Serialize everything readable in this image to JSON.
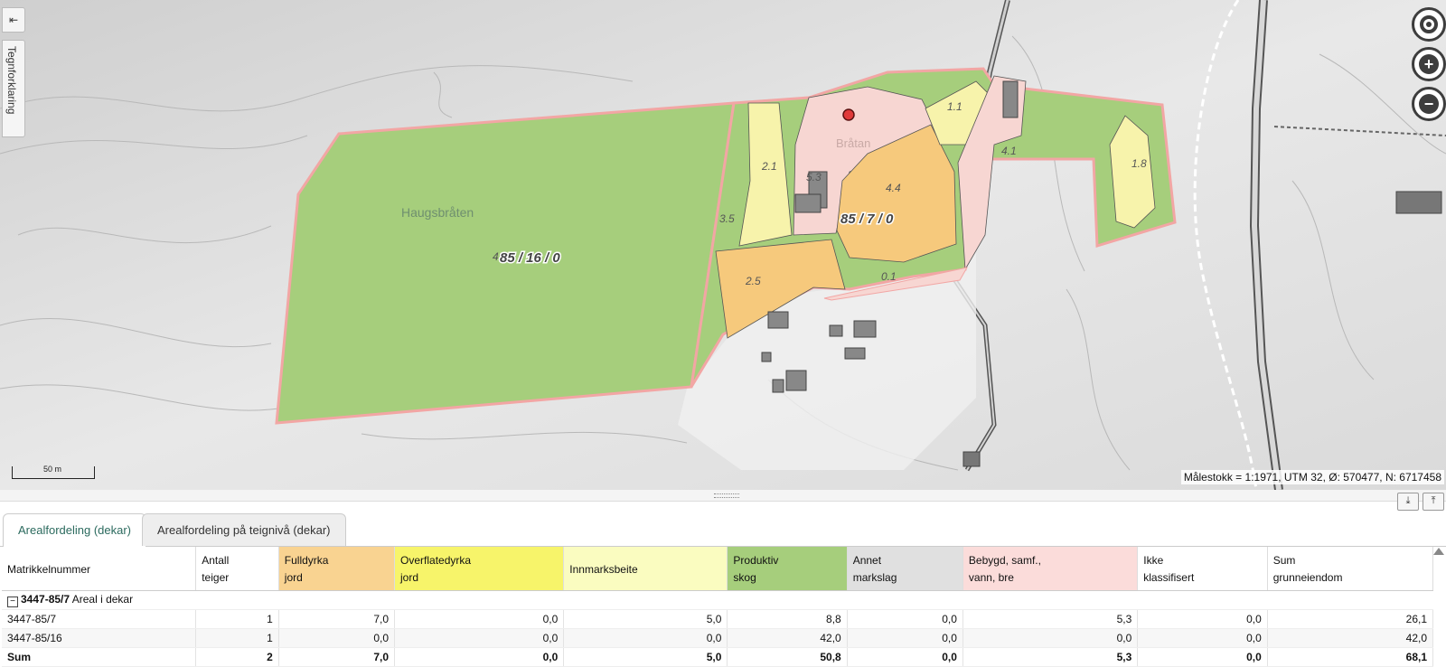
{
  "sidebar": {
    "legend_tab_label": "Tegnforklaring",
    "collapse_icon": "arrow-left-bar-icon"
  },
  "map": {
    "place_labels": [
      "Haugsbråten",
      "Bråtan"
    ],
    "parcel_labels": [
      "85 / 16 / 0",
      "85 / 7 / 0"
    ],
    "area_labels": [
      "2.1",
      "5.3",
      "4.4",
      "1.1",
      "4.1",
      "1.8",
      "3.5",
      "2.5",
      "0.1",
      "4"
    ],
    "scale_bar_label": "50 m",
    "scale_info": "Målestokk = 1:1971, UTM 32, Ø: 570477, N: 6717458",
    "colors": {
      "forest": "#a6ce7c",
      "fully_cultivated": "#f6c97c",
      "pasture": "#f7f3ab",
      "built": "#f7d6d2",
      "outline": "#f2a6a4"
    }
  },
  "map_controls": {
    "locate_icon": "locate-icon",
    "zoom_in_label": "+",
    "zoom_out_label": "−"
  },
  "panel_controls": {
    "dock_down_icon": "arrow-down-icon",
    "dock_up_icon": "arrow-up-icon"
  },
  "tabs": [
    {
      "label": "Arealfordeling (dekar)",
      "active": true
    },
    {
      "label": "Arealfordeling på teignivå (dekar)",
      "active": false
    }
  ],
  "table": {
    "headers": [
      {
        "line1": "Matrikkelnummer",
        "line2": "",
        "color": "#ffffff"
      },
      {
        "line1": "Antall",
        "line2": "teiger",
        "color": "#ffffff"
      },
      {
        "line1": "Fulldyrka",
        "line2": "jord",
        "color": "#f9d391"
      },
      {
        "line1": "Overflatedyrka",
        "line2": "jord",
        "color": "#f7f46a"
      },
      {
        "line1": "Innmarksbeite",
        "line2": "",
        "color": "#fafcc0"
      },
      {
        "line1": "Produktiv",
        "line2": "skog",
        "color": "#a6ce7c"
      },
      {
        "line1": "Annet",
        "line2": "markslag",
        "color": "#e0e0e0"
      },
      {
        "line1": "Bebygd, samf.,",
        "line2": "vann, bre",
        "color": "#fbdcda"
      },
      {
        "line1": "Ikke",
        "line2": "klassifisert",
        "color": "#ffffff"
      },
      {
        "line1": "Sum",
        "line2": "grunneiendom",
        "color": "#ffffff"
      }
    ],
    "group": {
      "id": "3447-85/7",
      "suffix": " Areal i dekar",
      "expander": "−"
    },
    "rows": [
      [
        "3447-85/7",
        "1",
        "7,0",
        "0,0",
        "5,0",
        "8,8",
        "0,0",
        "5,3",
        "0,0",
        "26,1"
      ],
      [
        "3447-85/16",
        "1",
        "0,0",
        "0,0",
        "0,0",
        "42,0",
        "0,0",
        "0,0",
        "0,0",
        "42,0"
      ]
    ],
    "sum_row": [
      "Sum",
      "2",
      "7,0",
      "0,0",
      "5,0",
      "50,8",
      "0,0",
      "5,3",
      "0,0",
      "68,1"
    ]
  }
}
